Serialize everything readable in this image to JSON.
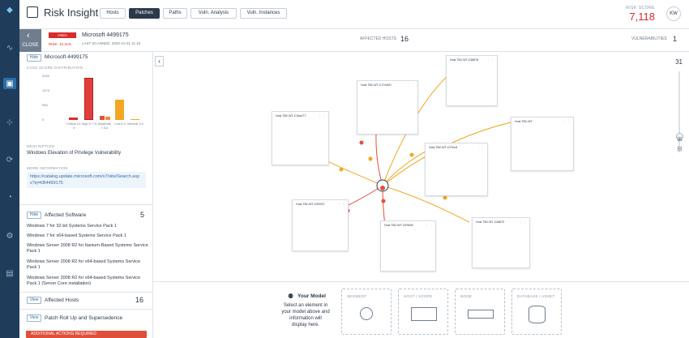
{
  "app": {
    "title": "Risk Insight"
  },
  "tabs": [
    {
      "label": "Hosts"
    },
    {
      "label": "Patches",
      "active": true
    },
    {
      "label": "Paths"
    },
    {
      "label": "Vuln. Analysis"
    },
    {
      "label": "Vuln. Instances"
    }
  ],
  "header": {
    "risk_label": "RISK SCORE",
    "risk_value": "7,118",
    "user_initials": "KW"
  },
  "info_bar": {
    "close_label": "CLOSE",
    "severity": "HIGH",
    "risk_pct": "RISK: 10.11%",
    "vuln_name": "Microsoft 4499175",
    "last_scanned": "LAST SCANNED: 2020-10-31 11:16",
    "affected_hosts_label": "AFFECTED HOSTS",
    "affected_hosts_value": "16",
    "vulnerabilities_label": "VULNERABILITIES",
    "vulnerabilities_value": "1"
  },
  "left_panel": {
    "hide_label": "Hide",
    "view_label": "View",
    "vuln_title": "Microsoft 4499175",
    "cvss_caption": "CVSS SCORE DISTRIBUTION",
    "description_caption": "DESCRIPTION",
    "description": "Windows Elevation of Privilege Vulnerability",
    "more_info_caption": "MORE INFORMATION",
    "more_info_link": "https://catalog.update.microsoft.com/v7/site/Search.aspx?q=KB4499175",
    "affected_software_title": "Affected Software",
    "affected_software_count": "5",
    "software": [
      "Windows 7 for 32-bit Systems Service Pack 1",
      "Windows 7 for x64-based Systems Service Pack 1",
      "Windows Server 2008 R2 for Itanium-Based Systems Service Pack 1",
      "Windows Server 2008 R2 for x64-based Systems Service Pack 1",
      "Windows Server 2008 R2 for x64-based Systems Service Pack 1 (Server Core installation)"
    ],
    "affected_hosts_title": "Affected Hosts",
    "affected_hosts_count": "16",
    "rollup_title": "Patch Roll Up and Supersedence",
    "warning": "ADDITIONAL ACTIONS REQUIRED"
  },
  "chart_data": {
    "type": "bar",
    "title": "CVSS SCORE DISTRIBUTION",
    "categories": [
      "Critical 10-9",
      "High 9~7.5",
      "Moderate 7.5-6",
      "Low 6-3",
      "Minimal 3-0"
    ],
    "bars": [
      {
        "category": "Critical 10-9",
        "values": [
          130
        ],
        "colors": [
          "#d92b2b"
        ]
      },
      {
        "category": "High 9~7.5",
        "values": [
          2430
        ],
        "colors": [
          "#d92b2b"
        ]
      },
      {
        "category": "Moderate 7.5-6",
        "values": [
          220,
          200
        ],
        "colors": [
          "#e04f3a",
          "#f28c28"
        ]
      },
      {
        "category": "Low 6-3",
        "values": [
          1150
        ],
        "colors": [
          "#f5a623"
        ]
      },
      {
        "category": "Minimal 3-0",
        "values": [
          0
        ],
        "colors": [
          "#f5a623"
        ]
      }
    ],
    "yticks": [
      "2049",
      "1474",
      "983",
      "0"
    ],
    "ylim": [
      0,
      2600
    ]
  },
  "canvas": {
    "zoom_value": "31",
    "hosts": [
      {
        "name": "Host TB2-WT-C38876"
      },
      {
        "name": "Host TB2-WT-C17440D"
      },
      {
        "name": "Host TB2-WT-C16a4T7"
      },
      {
        "name": "Host TB2-WT"
      },
      {
        "name": "Host TB2-WT-C47bc8"
      },
      {
        "name": "Host TB2-WT-C93S07"
      },
      {
        "name": "Host TB2-WT-C9S605"
      },
      {
        "name": "Host TB2-WT-C26670"
      }
    ]
  },
  "bottom_panel": {
    "your_model_title": "Your Model",
    "your_model_text": "Select an element in your model above and information will display here.",
    "boxes": [
      "SEGMENT",
      "HOST / SCOPE",
      "NODE",
      "DATABASE / ASSET"
    ]
  },
  "colors": {
    "accent": "#2c6ea7",
    "rail": "#1f3c5b",
    "danger": "#d92b2b",
    "warn": "#f5a623"
  }
}
